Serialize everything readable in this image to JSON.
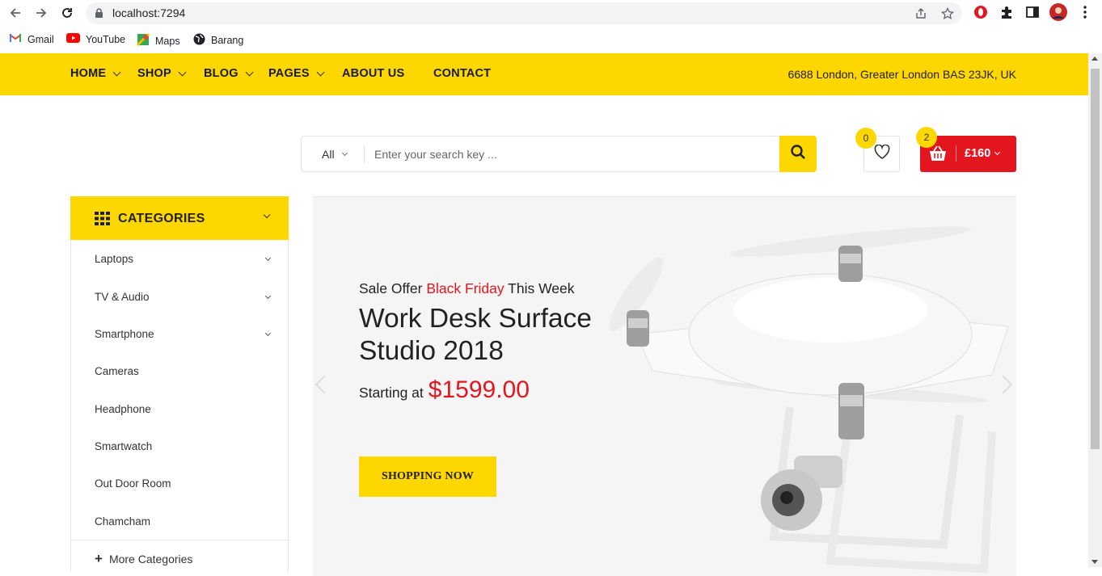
{
  "browser": {
    "url": "localhost:7294",
    "bookmarks": [
      {
        "label": "Gmail",
        "icon": "gmail-icon"
      },
      {
        "label": "YouTube",
        "icon": "youtube-icon"
      },
      {
        "label": "Maps",
        "icon": "maps-icon"
      },
      {
        "label": "Barang",
        "icon": "globe-icon"
      }
    ]
  },
  "nav": {
    "items": [
      {
        "label": "HOME",
        "dropdown": true
      },
      {
        "label": "SHOP",
        "dropdown": true
      },
      {
        "label": "BLOG",
        "dropdown": true
      },
      {
        "label": "PAGES",
        "dropdown": true
      },
      {
        "label": "ABOUT US",
        "dropdown": false
      },
      {
        "label": "CONTACT",
        "dropdown": false
      }
    ],
    "address": "6688 London, Greater London BAS 23JK, UK"
  },
  "search": {
    "category": "All",
    "placeholder": "Enter your search key ..."
  },
  "wishlist": {
    "count": "0"
  },
  "cart": {
    "count": "2",
    "total": "£160"
  },
  "categories": {
    "title": "CATEGORIES",
    "items": [
      {
        "label": "Laptops",
        "expandable": true
      },
      {
        "label": "TV & Audio",
        "expandable": true
      },
      {
        "label": "Smartphone",
        "expandable": true
      },
      {
        "label": "Cameras",
        "expandable": false
      },
      {
        "label": "Headphone",
        "expandable": false
      },
      {
        "label": "Smartwatch",
        "expandable": false
      },
      {
        "label": "Out Door Room",
        "expandable": false
      },
      {
        "label": "Chamcham",
        "expandable": false
      }
    ],
    "more": "More Categories"
  },
  "hero": {
    "sale_prefix": "Sale Offer",
    "sale_highlight": "Black Friday",
    "sale_suffix": "This Week",
    "title": "Work Desk Surface Studio 2018",
    "price_prefix": "Starting at",
    "price": "$1599.00",
    "cta": "SHOPPING NOW"
  },
  "colors": {
    "accent": "#fed700",
    "red": "#e3161f"
  }
}
